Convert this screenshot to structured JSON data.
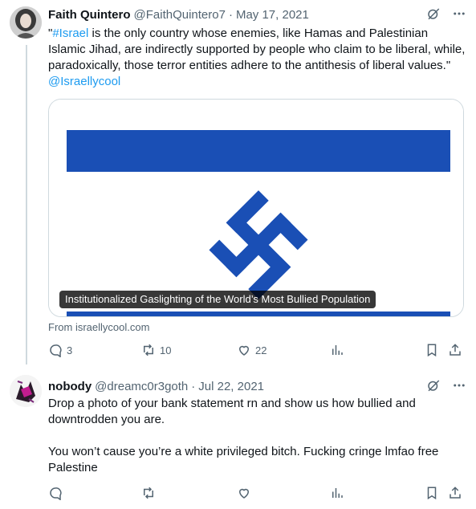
{
  "tweet1": {
    "name": "Faith Quintero",
    "handle": "@FaithQuintero7",
    "separator": "·",
    "date": "May 17, 2021",
    "text_open_quote": "\"",
    "hashtag": "#Israel",
    "text_body": " is the only country whose enemies, like Hamas and Palestinian Islamic Jihad, are indirectly supported by people who claim to be liberal, while, paradoxically, those terror entities adhere to the antithesis of liberal values.\" ",
    "mention": "@Israellycool",
    "card": {
      "caption": "Institutionalized Gaslighting of the World’s Most Bullied Population",
      "source": "From israellycool.com"
    },
    "actions": {
      "replies": "3",
      "retweets": "10",
      "likes": "22"
    }
  },
  "tweet2": {
    "name": "nobody",
    "handle": "@dreamc0r3goth",
    "separator": "·",
    "date": "Jul 22, 2021",
    "para1": "Drop a photo of your bank statement rn and show us how bullied and downtrodden you are.",
    "para2": "You won’t cause you’re a white privileged bitch. Fucking cringe lmfao free Palestine",
    "actions": {
      "replies": "",
      "retweets": "",
      "likes": ""
    }
  },
  "icons": [
    "grok-icon",
    "more-icon",
    "reply-icon",
    "retweet-icon",
    "like-icon",
    "views-icon",
    "bookmark-icon",
    "share-icon"
  ],
  "colors": {
    "link": "#1d9bf0",
    "secondary": "#536471",
    "flag_blue": "#1a4fb5",
    "border": "#cfd9de"
  }
}
